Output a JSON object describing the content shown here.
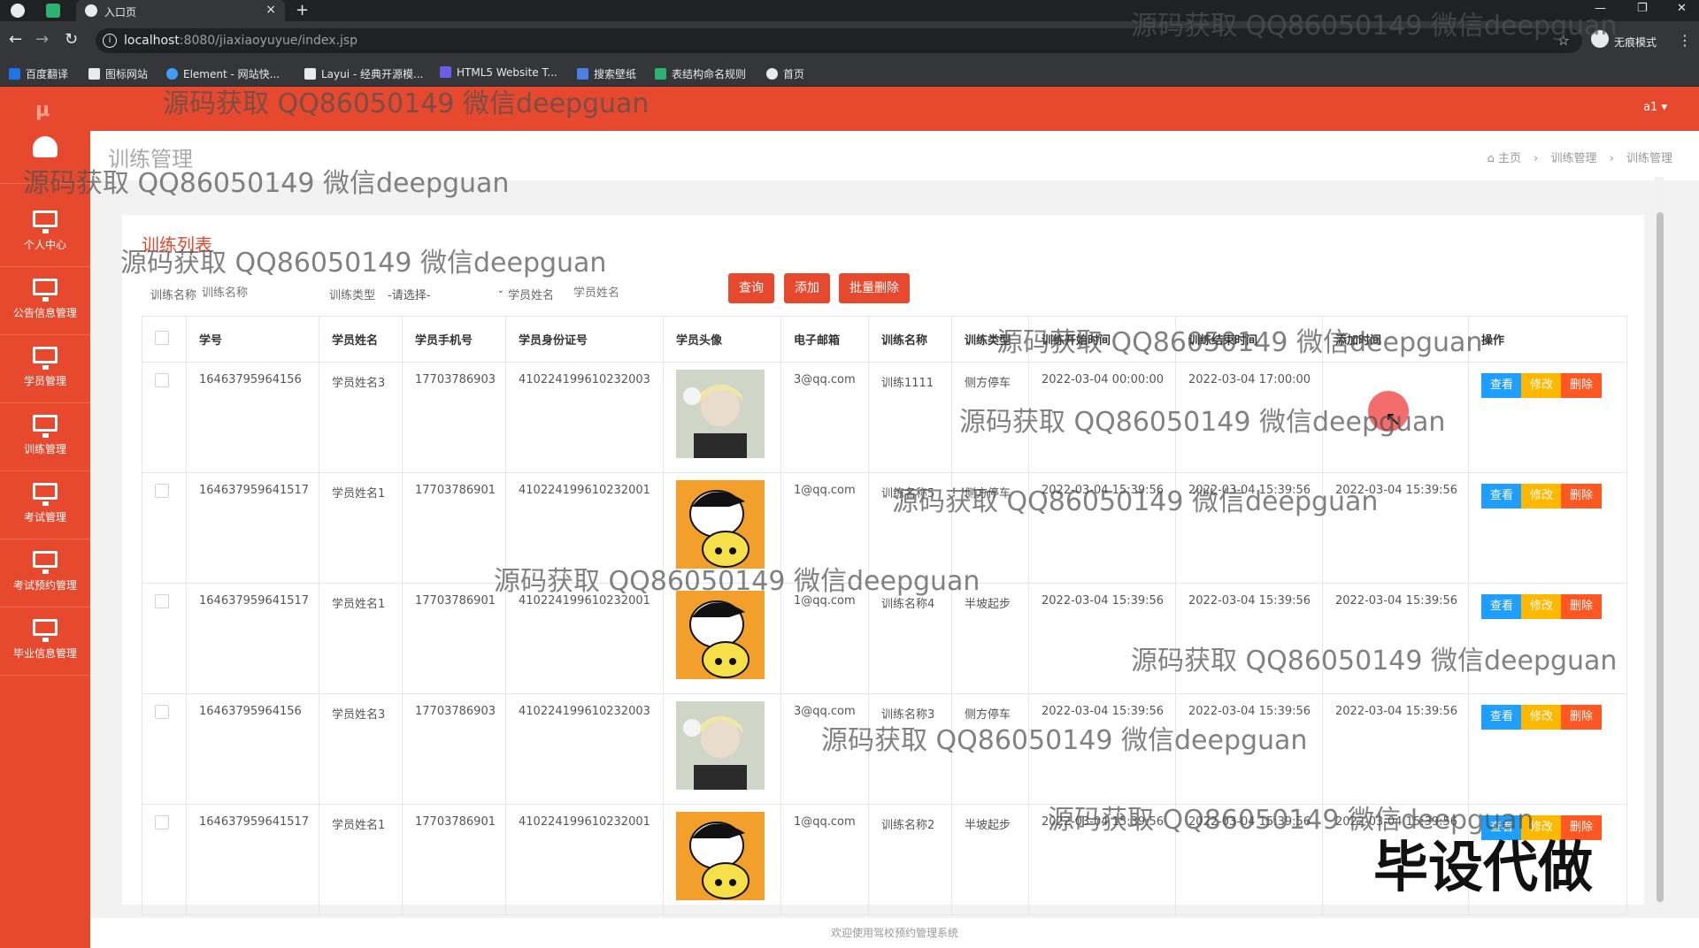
{
  "browser": {
    "tab_title": "入口页",
    "url_host": "localhost",
    "url_path": ":8080/jiaxiaoyuyue/index.jsp",
    "incognito_label": "无痕模式",
    "bookmarks": [
      {
        "label": "百度翻译",
        "color": "#1e73e8"
      },
      {
        "label": "图标网站",
        "color": "#e8eaed"
      },
      {
        "label": "Element - 网站快...",
        "color": "#409eff"
      },
      {
        "label": "Layui - 经典开源模...",
        "color": "#e8eaed"
      },
      {
        "label": "HTML5 Website T...",
        "color": "#6c5ce7"
      },
      {
        "label": "搜索壁纸",
        "color": "#4a7fe8"
      },
      {
        "label": "表结构命名规则",
        "color": "#2db36f"
      },
      {
        "label": "首页",
        "color": "#e8eaed"
      }
    ]
  },
  "app": {
    "logo": "μ",
    "user": "a1 ▾",
    "sidebar": [
      {
        "label": "个人中心"
      },
      {
        "label": "公告信息管理"
      },
      {
        "label": "学员管理"
      },
      {
        "label": "训练管理"
      },
      {
        "label": "考试管理"
      },
      {
        "label": "考试预约管理"
      },
      {
        "label": "毕业信息管理"
      }
    ],
    "page_title": "训练管理",
    "breadcrumb": {
      "home": "主页",
      "level1": "训练管理",
      "level2": "训练管理"
    },
    "card_title": "训练列表",
    "filters": {
      "name_label": "训练名称",
      "name_placeholder": "训练名称",
      "type_label": "训练类型",
      "type_value": "-请选择-",
      "student_label": "学员姓名",
      "student_placeholder": "学员姓名"
    },
    "buttons": {
      "query": "查询",
      "add": "添加",
      "batch_delete": "批量删除"
    },
    "columns": [
      "学号",
      "学员姓名",
      "学员手机号",
      "学员身份证号",
      "学员头像",
      "电子邮箱",
      "训练名称",
      "训练类型",
      "训练开始时间",
      "训练结束时间",
      "添加时间",
      "操作"
    ],
    "rows": [
      {
        "id": "16463795964156",
        "name": "学员姓名3",
        "phone": "17703786903",
        "idcard": "410224199610232003",
        "avatar": "photo",
        "email": "3@qq.com",
        "train_name": "训练1111",
        "train_type": "侧方停车",
        "start": "2022-03-04 00:00:00",
        "end": "2022-03-04 17:00:00",
        "added": ""
      },
      {
        "id": "164637959641517",
        "name": "学员姓名1",
        "phone": "17703786901",
        "idcard": "410224199610232001",
        "avatar": "cartoon",
        "email": "1@qq.com",
        "train_name": "训练名称5",
        "train_type": "侧方停车",
        "start": "2022-03-04 15:39:56",
        "end": "2022-03-04 15:39:56",
        "added": "2022-03-04 15:39:56"
      },
      {
        "id": "164637959641517",
        "name": "学员姓名1",
        "phone": "17703786901",
        "idcard": "410224199610232001",
        "avatar": "cartoon",
        "email": "1@qq.com",
        "train_name": "训练名称4",
        "train_type": "半坡起步",
        "start": "2022-03-04 15:39:56",
        "end": "2022-03-04 15:39:56",
        "added": "2022-03-04 15:39:56"
      },
      {
        "id": "16463795964156",
        "name": "学员姓名3",
        "phone": "17703786903",
        "idcard": "410224199610232003",
        "avatar": "photo",
        "email": "3@qq.com",
        "train_name": "训练名称3",
        "train_type": "侧方停车",
        "start": "2022-03-04 15:39:56",
        "end": "2022-03-04 15:39:56",
        "added": "2022-03-04 15:39:56"
      },
      {
        "id": "164637959641517",
        "name": "学员姓名1",
        "phone": "17703786901",
        "idcard": "410224199610232001",
        "avatar": "cartoon",
        "email": "1@qq.com",
        "train_name": "训练名称2",
        "train_type": "半坡起步",
        "start": "2022-03-04 15:39:56",
        "end": "2022-03-04 15:39:56",
        "added": "2022-03-04 15:39:56"
      }
    ],
    "row_actions": {
      "view": "查看",
      "edit": "修改",
      "delete": "删除"
    },
    "footer": "欢迎使用驾校预约管理系统"
  },
  "overlay": {
    "watermark": "源码获取 QQ86050149 微信deepguan",
    "stamp": "毕设代做"
  },
  "colors": {
    "primary": "#e6492d",
    "view": "#1e9fff",
    "edit": "#ffb800",
    "delete": "#ff5722"
  }
}
